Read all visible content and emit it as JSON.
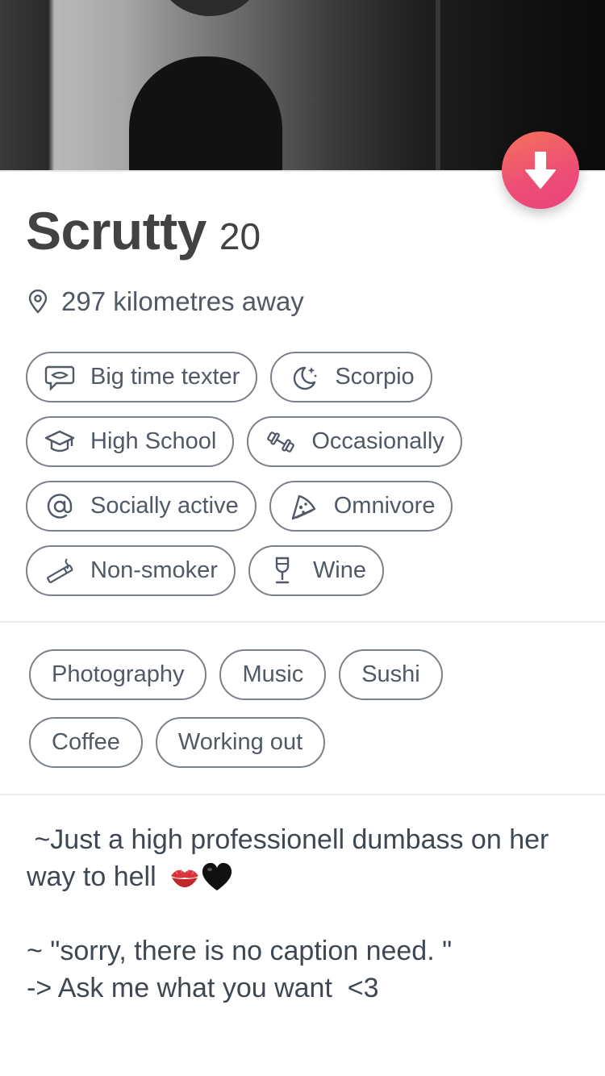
{
  "profile": {
    "name": "Scrutty",
    "age": "20",
    "distance": "297 kilometres away"
  },
  "colors": {
    "accent_gradient_start": "#f4735a",
    "accent_gradient_end": "#e9437d",
    "text_primary": "#424242",
    "chip_border": "#7a808a"
  },
  "basics": [
    {
      "label": "Big time texter",
      "icon": "chat-bubble-icon"
    },
    {
      "label": "Scorpio",
      "icon": "moon-stars-icon"
    },
    {
      "label": "High School",
      "icon": "graduation-cap-icon"
    },
    {
      "label": "Occasionally",
      "icon": "dumbbell-icon"
    },
    {
      "label": "Socially active",
      "icon": "at-sign-icon"
    },
    {
      "label": "Omnivore",
      "icon": "pizza-slice-icon"
    },
    {
      "label": "Non-smoker",
      "icon": "cigarette-icon"
    },
    {
      "label": "Wine",
      "icon": "wine-glass-icon"
    }
  ],
  "interests": [
    "Photography",
    "Music",
    "Sushi",
    "Coffee",
    "Working out"
  ],
  "bio": {
    "line1": " ~Just a high professionell dumbass on her way to hell ",
    "line1_emojis": [
      "kiss-mark-emoji",
      "black-heart-emoji"
    ],
    "line2": "~ \"sorry, there is no caption need. \"",
    "line3": "-> Ask me what you want  <3"
  }
}
